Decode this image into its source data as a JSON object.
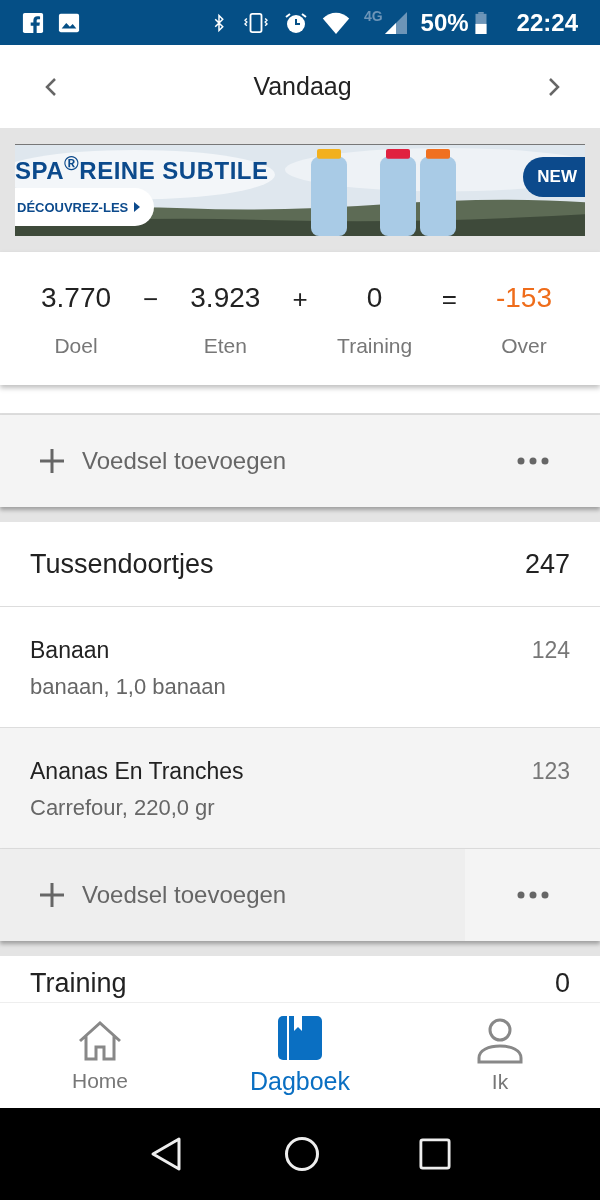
{
  "status_bar": {
    "network": "4G",
    "battery": "50%",
    "time": "22:24"
  },
  "header": {
    "title": "Vandaag"
  },
  "ad": {
    "headline": "SPA$^{®}$REINE SUBTILE",
    "cta": "DÉCOUVREZ-LES",
    "badge": "NEW"
  },
  "summary": [
    {
      "value": "3.770",
      "label": "Doel",
      "operator": "−",
      "kind": "normal"
    },
    {
      "value": "3.923",
      "label": "Eten",
      "operator": "+",
      "kind": "normal"
    },
    {
      "value": "0",
      "label": "Training",
      "operator": "=",
      "kind": "normal"
    },
    {
      "value": "-153",
      "label": "Over",
      "kind": "negative"
    }
  ],
  "sections": [
    {
      "kind": "tail",
      "add_label": "Voedsel toevoegen"
    },
    {
      "kind": "meal",
      "title": "Tussendoortjes",
      "total": "247",
      "items": [
        {
          "name": "Banaan",
          "detail": "banaan, 1,0 banaan",
          "calories": "124"
        },
        {
          "name": "Ananas En Tranches",
          "detail": "Carrefour, 220,0 gr",
          "calories": "123"
        }
      ],
      "add_label": "Voedsel toevoegen"
    },
    {
      "kind": "cut",
      "title": "Training",
      "total": "0"
    }
  ],
  "bottom_nav": [
    {
      "label": "Home",
      "selected": false
    },
    {
      "label": "Dagboek",
      "selected": true
    },
    {
      "label": "Ik",
      "selected": false
    }
  ]
}
